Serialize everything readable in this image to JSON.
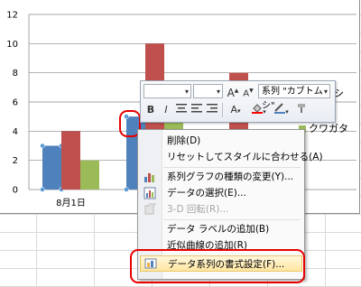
{
  "chart_data": {
    "type": "bar",
    "categories": [
      "8月1日",
      "",
      ""
    ],
    "series": [
      {
        "name": "",
        "values": [
          3,
          5,
          0
        ],
        "color": "#4f81bd"
      },
      {
        "name": "系列 \"カブトムシ\"",
        "values": [
          4,
          10,
          8
        ],
        "color": "#c0504d"
      },
      {
        "name": "クワガタ",
        "values": [
          2,
          5,
          0
        ],
        "color": "#9bbb59"
      }
    ],
    "ylim": [
      0,
      12
    ],
    "yticks": [
      "0",
      "2",
      "4",
      "6",
      "8",
      "10",
      "12"
    ],
    "grid": true,
    "legend_visible": [
      {
        "text": "シ",
        "series": 1
      },
      {
        "text": "クワガタ",
        "series": 2
      }
    ]
  },
  "mini_toolbar": {
    "series_selector": "系列 \"カブトムシ\"",
    "bold": "B",
    "italic": "I",
    "font_grow": "A",
    "font_shrink": "A"
  },
  "context_menu": {
    "items": [
      {
        "label": "削除(D)",
        "icon": "none",
        "disabled": false
      },
      {
        "label": "リセットしてスタイルに合わせる(A)",
        "icon": "none",
        "disabled": false
      },
      {
        "label": "系列グラフの種類の変更(Y)...",
        "icon": "chart-type-icon",
        "disabled": false
      },
      {
        "label": "データの選択(E)...",
        "icon": "data-select-icon",
        "disabled": false
      },
      {
        "label": "3-D 回転(R)...",
        "icon": "rotate-3d-icon",
        "disabled": true
      },
      {
        "label": "データ ラベルの追加(B)",
        "icon": "none",
        "disabled": false
      },
      {
        "label": "近似曲線の追加(R)",
        "icon": "none",
        "disabled": false
      },
      {
        "label": "データ系列の書式設定(F)...",
        "icon": "format-series-icon",
        "disabled": false
      }
    ]
  }
}
